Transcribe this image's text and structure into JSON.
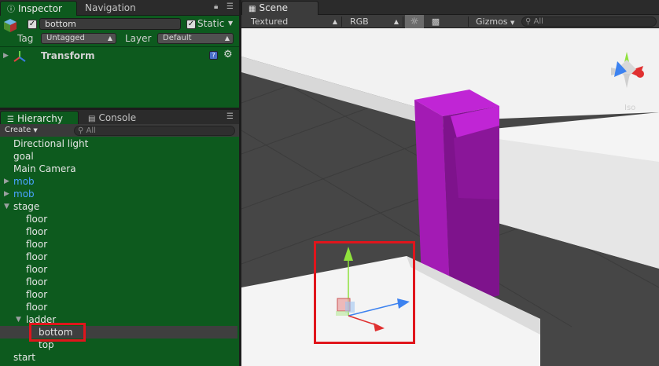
{
  "inspector": {
    "tabs": [
      "Inspector",
      "Navigation"
    ],
    "object_name": "bottom",
    "static_label": "Static",
    "tag_label": "Tag",
    "tag_value": "Untagged",
    "layer_label": "Layer",
    "layer_value": "Default",
    "component_title": "Transform"
  },
  "hierarchy": {
    "tabs": [
      "Hierarchy",
      "Console"
    ],
    "create_label": "Create",
    "search_placeholder": "All",
    "items": [
      {
        "label": "Directional light",
        "depth": 0,
        "type": "object"
      },
      {
        "label": "goal",
        "depth": 0,
        "type": "object"
      },
      {
        "label": "Main Camera",
        "depth": 0,
        "type": "object"
      },
      {
        "label": "mob",
        "depth": 0,
        "type": "prefab",
        "expand": "collapsed"
      },
      {
        "label": "mob",
        "depth": 0,
        "type": "prefab",
        "expand": "collapsed"
      },
      {
        "label": "stage",
        "depth": 0,
        "type": "object",
        "expand": "expanded"
      },
      {
        "label": "floor",
        "depth": 1,
        "type": "object"
      },
      {
        "label": "floor",
        "depth": 1,
        "type": "object"
      },
      {
        "label": "floor",
        "depth": 1,
        "type": "object"
      },
      {
        "label": "floor",
        "depth": 1,
        "type": "object"
      },
      {
        "label": "floor",
        "depth": 1,
        "type": "object"
      },
      {
        "label": "floor",
        "depth": 1,
        "type": "object"
      },
      {
        "label": "floor",
        "depth": 1,
        "type": "object"
      },
      {
        "label": "floor",
        "depth": 1,
        "type": "object"
      },
      {
        "label": "ladder",
        "depth": 1,
        "type": "object",
        "expand": "expanded"
      },
      {
        "label": "bottom",
        "depth": 2,
        "type": "object",
        "selected": true
      },
      {
        "label": "top",
        "depth": 2,
        "type": "object"
      },
      {
        "label": "start",
        "depth": 0,
        "type": "object"
      }
    ]
  },
  "scene": {
    "tab": "Scene",
    "render_mode": "Textured",
    "color_mode": "RGB",
    "gizmos_label": "Gizmos",
    "search_placeholder": "All",
    "view_label": "Iso"
  },
  "colors": {
    "panel_green": "#0d5a1e",
    "prefab_blue": "#4aa3ff",
    "highlight_red": "#e0151c",
    "ladder_magenta": "#b21ac2"
  },
  "icons": [
    "gameobject-icon",
    "lock-icon",
    "menu-icon",
    "transform-axes-icon",
    "help-icon",
    "gear-icon",
    "search-icon",
    "sun-icon",
    "image-icon",
    "scene-gizmo-icon",
    "move-gizmo-icon"
  ]
}
